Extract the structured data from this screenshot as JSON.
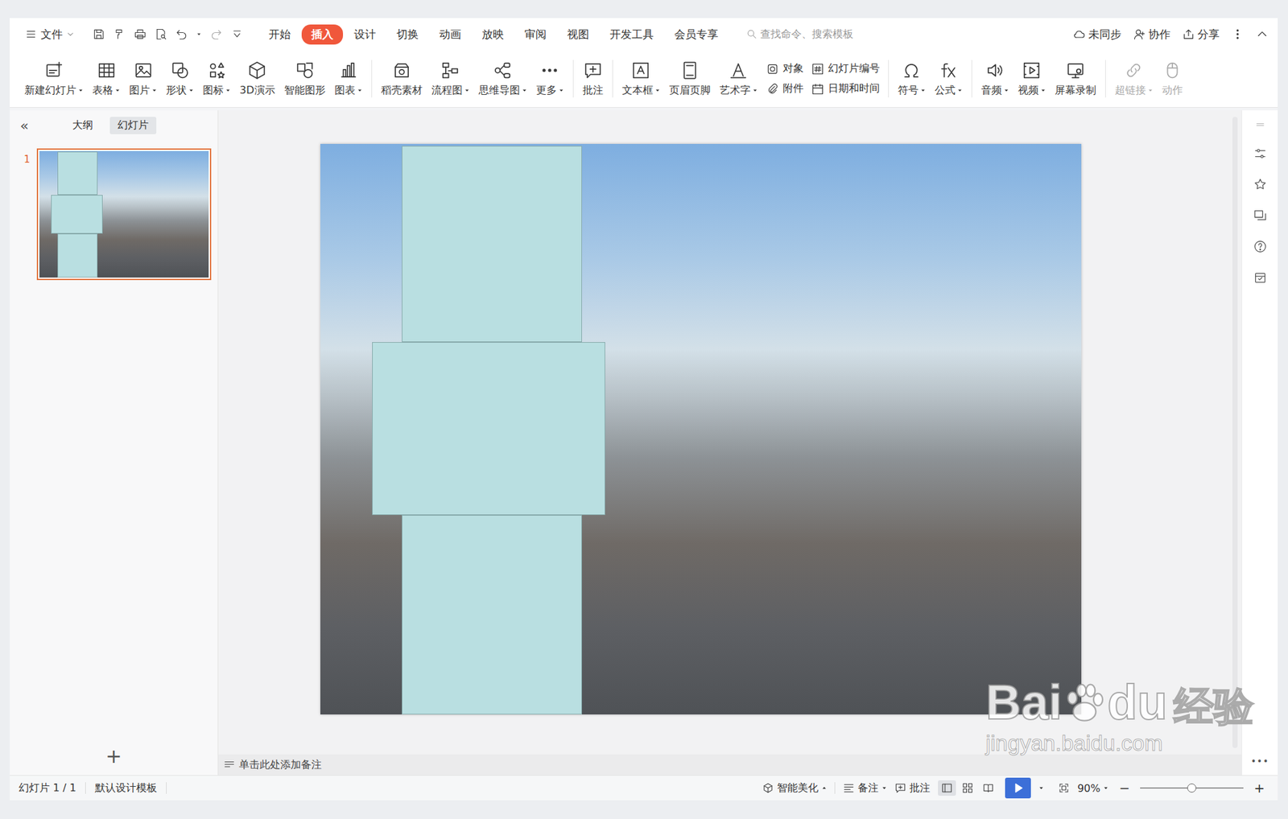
{
  "menu": {
    "file": "文件",
    "tabs": [
      {
        "label": "开始",
        "selected": false
      },
      {
        "label": "插入",
        "selected": true
      },
      {
        "label": "设计",
        "selected": false
      },
      {
        "label": "切换",
        "selected": false
      },
      {
        "label": "动画",
        "selected": false
      },
      {
        "label": "放映",
        "selected": false
      },
      {
        "label": "审阅",
        "selected": false
      },
      {
        "label": "视图",
        "selected": false
      },
      {
        "label": "开发工具",
        "selected": false
      },
      {
        "label": "会员专享",
        "selected": false
      }
    ],
    "search": {
      "placeholder": "查找命令、搜索模板"
    },
    "right": [
      "未同步",
      "协作",
      "分享"
    ]
  },
  "ribbon": [
    {
      "items": [
        {
          "kind": "large",
          "label": "新建幻灯片",
          "dropdown": true,
          "disabled": false
        },
        {
          "kind": "large",
          "label": "表格",
          "dropdown": true,
          "disabled": false
        },
        {
          "kind": "large",
          "label": "图片",
          "dropdown": true,
          "disabled": false
        },
        {
          "kind": "large",
          "label": "形状",
          "dropdown": true,
          "disabled": false
        },
        {
          "kind": "large",
          "label": "图标",
          "dropdown": true,
          "disabled": false
        },
        {
          "kind": "large",
          "label": "3D演示",
          "dropdown": false,
          "disabled": false
        },
        {
          "kind": "large",
          "label": "智能图形",
          "dropdown": false,
          "disabled": false
        },
        {
          "kind": "large",
          "label": "图表",
          "dropdown": true,
          "disabled": false
        }
      ]
    },
    {
      "items": [
        {
          "kind": "large",
          "label": "稻壳素材",
          "dropdown": false,
          "disabled": false
        },
        {
          "kind": "large",
          "label": "流程图",
          "dropdown": true,
          "disabled": false
        },
        {
          "kind": "large",
          "label": "思维导图",
          "dropdown": true,
          "disabled": false
        },
        {
          "kind": "large",
          "label": "更多",
          "dropdown": true,
          "disabled": false
        }
      ]
    },
    {
      "items": [
        {
          "kind": "large",
          "label": "批注",
          "dropdown": false,
          "disabled": false
        }
      ]
    },
    {
      "items": [
        {
          "kind": "large",
          "label": "文本框",
          "dropdown": true,
          "disabled": false
        },
        {
          "kind": "large",
          "label": "页眉页脚",
          "dropdown": false,
          "disabled": false
        },
        {
          "kind": "large",
          "label": "艺术字",
          "dropdown": true,
          "disabled": false
        },
        {
          "kind": "stack",
          "top": {
            "label": "对象"
          },
          "bottom": {
            "label": "附件"
          }
        },
        {
          "kind": "stack",
          "top": {
            "label": "幻灯片编号"
          },
          "bottom": {
            "label": "日期和时间"
          }
        }
      ]
    },
    {
      "items": [
        {
          "kind": "large",
          "label": "符号",
          "dropdown": true,
          "disabled": false
        },
        {
          "kind": "large",
          "label": "公式",
          "dropdown": true,
          "disabled": false
        }
      ]
    },
    {
      "items": [
        {
          "kind": "large",
          "label": "音频",
          "dropdown": true,
          "disabled": false
        },
        {
          "kind": "large",
          "label": "视频",
          "dropdown": true,
          "disabled": false
        },
        {
          "kind": "large",
          "label": "屏幕录制",
          "dropdown": false,
          "disabled": false
        }
      ]
    },
    {
      "items": [
        {
          "kind": "large",
          "label": "超链接",
          "dropdown": true,
          "disabled": true
        },
        {
          "kind": "large",
          "label": "动作",
          "dropdown": false,
          "disabled": true
        }
      ]
    }
  ],
  "left_panel": {
    "collapse": "«",
    "tabs": [
      {
        "label": "大纲",
        "selected": false
      },
      {
        "label": "幻灯片",
        "selected": true
      }
    ],
    "slides": [
      {
        "number": "1",
        "selected": true
      }
    ],
    "add": "+"
  },
  "notes": {
    "placeholder": "单击此处添加备注"
  },
  "sidebar": {
    "more": "•••"
  },
  "status_bar": {
    "slide": "幻灯片 1 / 1",
    "template": "默认设计模板",
    "smart": "智能美化",
    "notes": "备注",
    "comments": "批注",
    "views": [
      {
        "selected": true
      },
      {
        "selected": false
      },
      {
        "selected": false
      }
    ],
    "zoom": "90%",
    "zoom_minus": "−",
    "zoom_plus": "+",
    "zoom_level": 0.5
  },
  "watermark": {
    "texts": [
      "Bai",
      "du",
      "经验"
    ],
    "url": "jingyan.baidu.com"
  }
}
